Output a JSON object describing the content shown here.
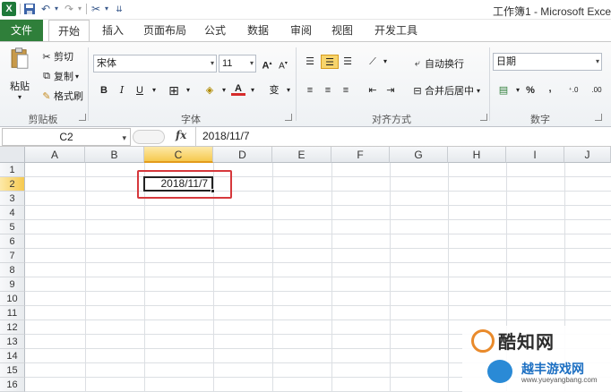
{
  "titlebar": {
    "app_icon": "X",
    "window_title": "工作簿1 - Microsoft Exce",
    "quick_access": [
      "save-icon",
      "undo-icon",
      "redo-icon",
      "customize-icon"
    ]
  },
  "tabs": [
    {
      "label": "文件"
    },
    {
      "label": "开始"
    },
    {
      "label": "插入"
    },
    {
      "label": "页面布局"
    },
    {
      "label": "公式"
    },
    {
      "label": "数据"
    },
    {
      "label": "审阅"
    },
    {
      "label": "视图"
    },
    {
      "label": "开发工具"
    }
  ],
  "ribbon": {
    "clipboard": {
      "paste": "粘贴",
      "cut": "剪切",
      "copy": "复制",
      "format_painter": "格式刷",
      "label": "剪贴板"
    },
    "font": {
      "name": "宋体",
      "size": "11",
      "label": "字体",
      "bold": "B",
      "italic": "I",
      "underline": "U"
    },
    "alignment": {
      "wrap_text": "自动换行",
      "merge_center": "合并后居中",
      "label": "对齐方式"
    },
    "number": {
      "format": "日期",
      "percent": "%",
      "comma": ",",
      "label": "数字"
    }
  },
  "formula_bar": {
    "name_box": "C2",
    "fx": "fx",
    "value": "2018/11/7"
  },
  "grid": {
    "columns": [
      "A",
      "B",
      "C",
      "D",
      "E",
      "F",
      "G",
      "H",
      "I",
      "J"
    ],
    "rows": [
      "1",
      "2",
      "3",
      "4",
      "5",
      "6",
      "7",
      "8",
      "9",
      "10",
      "11",
      "12",
      "13",
      "14",
      "15",
      "16"
    ],
    "selected_column": "C",
    "selected_row": "2",
    "active_cell_value": "2018/11/7"
  },
  "watermark": {
    "line1": "酷知网",
    "line2": "越丰游戏网",
    "line3": "www.yueyangbang.com"
  },
  "colors": {
    "file_tab": "#2f7f3a",
    "selection": "#f6c94f",
    "highlight_box": "#d6383c"
  }
}
